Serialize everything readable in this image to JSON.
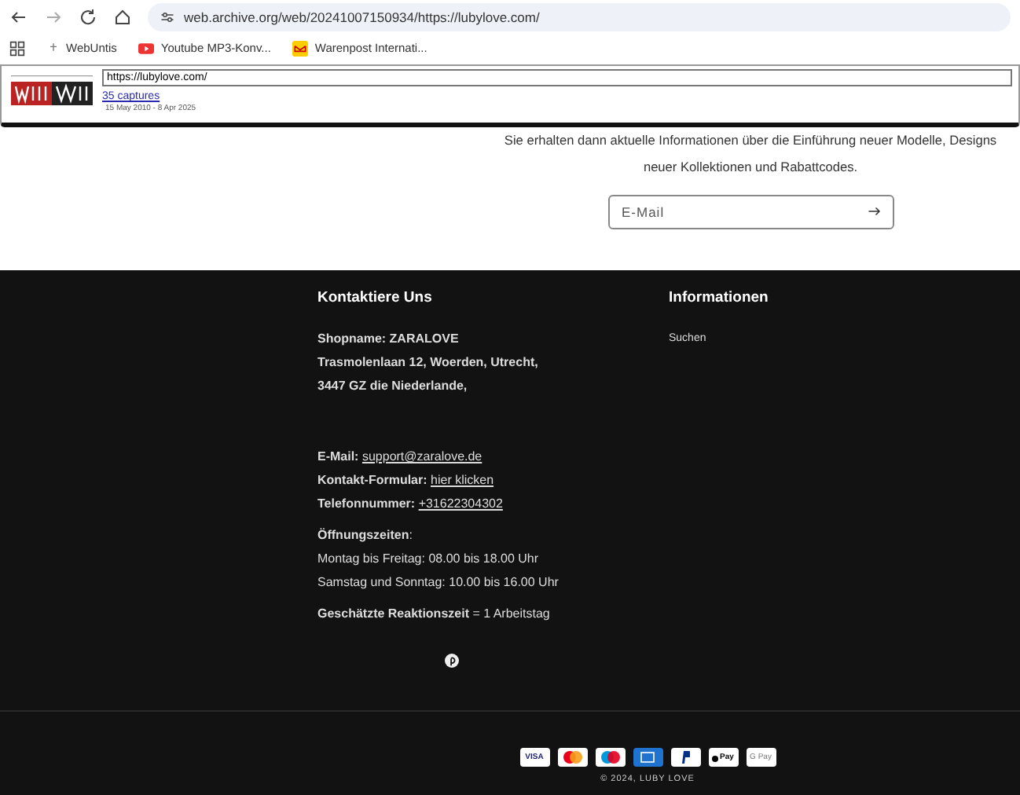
{
  "browser": {
    "url": "web.archive.org/web/20241007150934/https://lubylove.com/",
    "bookmarks": [
      {
        "kind": "plain",
        "label": "WebUntis"
      },
      {
        "kind": "video",
        "label": "Youtube MP3-Konv..."
      },
      {
        "kind": "post",
        "label": "Warenpost Internati..."
      }
    ]
  },
  "wayback": {
    "url": "https://lubylove.com/",
    "captures": "35 captures",
    "date_range": "15 May 2010 - 8 Apr 2025"
  },
  "newsletter": {
    "lines": [
      "Sie erhalten dann aktuelle Informationen über die Einführung neuer Modelle, Designs",
      "neuer Kollektionen und Rabattcodes."
    ],
    "email_placeholder": "E-Mail"
  },
  "footer": {
    "contact": {
      "heading": "Kontaktiere Uns",
      "blocks": [
        {
          "kind": "bold",
          "lines": [
            "Shopname: ZARALOVE",
            "Trasmolenlaan 12, Woerden, Utrecht,",
            "3447 GZ die Niederlande,"
          ]
        },
        {
          "kind": "fields",
          "items": [
            {
              "label": "E-Mail:",
              "link": "support@zaralove.de"
            },
            {
              "label": "Kontakt-Formular:",
              "link": "hier klicken"
            },
            {
              "label": "Telefonnummer:",
              "link": "+31622304302"
            }
          ]
        },
        {
          "kind": "plain",
          "lines": [
            "**Öffnungszeiten**:",
            "Montag bis Freitag: 08.00 bis 18.00 Uhr",
            "Samstag und Sonntag: 10.00 bis 16.00 Uhr"
          ]
        },
        {
          "kind": "plain",
          "lines": [
            "**Geschätzte Reaktionszeit** = 1 Arbeitstag"
          ]
        }
      ]
    },
    "info": {
      "heading": "Informationen",
      "links": [
        "Suchen"
      ]
    },
    "payments": [
      {
        "kind": "visa",
        "text": "VISA"
      },
      {
        "kind": "mastercard"
      },
      {
        "kind": "maestro"
      },
      {
        "kind": "amex"
      },
      {
        "kind": "paypal"
      },
      {
        "kind": "applepay",
        "text": "Pay"
      },
      {
        "kind": "googlepay",
        "text": "G Pay"
      }
    ],
    "copyright": "© 2024, LUBY LOVE"
  }
}
